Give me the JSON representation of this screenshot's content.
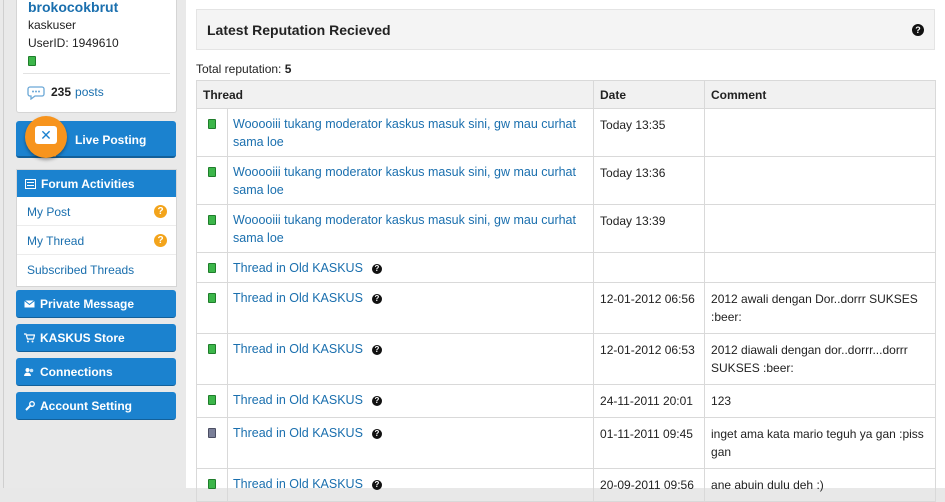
{
  "profile": {
    "username": "brokocokbrut",
    "user_title": "kaskuser",
    "user_id": "UserID: 1949610",
    "posts_count": "235",
    "posts_label": "posts"
  },
  "sidebar": {
    "live_posting": "Live Posting",
    "forum_activities": {
      "title": "Forum Activities",
      "items": [
        {
          "label": "My Post",
          "has_help": true
        },
        {
          "label": "My Thread",
          "has_help": true
        },
        {
          "label": "Subscribed Threads",
          "has_help": false
        }
      ]
    },
    "buttons": [
      {
        "label": "Private Message",
        "icon": "envelope-icon"
      },
      {
        "label": "KASKUS Store",
        "icon": "cart-icon"
      },
      {
        "label": "Connections",
        "icon": "people-icon"
      },
      {
        "label": "Account Setting",
        "icon": "wrench-icon"
      }
    ]
  },
  "main": {
    "title": "Latest Reputation Recieved",
    "total_label": "Total reputation:",
    "total_value": "5",
    "columns": [
      "Thread",
      "Date",
      "Comment"
    ],
    "rows": [
      {
        "status": "green",
        "thread": "Wooooiii tukang moderator kaskus masuk sini, gw mau curhat sama loe",
        "has_help": false,
        "date": "Today 13:35",
        "comment": ""
      },
      {
        "status": "green",
        "thread": "Wooooiii tukang moderator kaskus masuk sini, gw mau curhat sama loe",
        "has_help": false,
        "date": "Today 13:36",
        "comment": ""
      },
      {
        "status": "green",
        "thread": "Wooooiii tukang moderator kaskus masuk sini, gw mau curhat sama loe",
        "has_help": false,
        "date": "Today 13:39",
        "comment": ""
      },
      {
        "status": "green",
        "thread": "Thread in Old KASKUS",
        "has_help": true,
        "date": "",
        "comment": ""
      },
      {
        "status": "green",
        "thread": "Thread in Old KASKUS",
        "has_help": true,
        "date": "12-01-2012 06:56",
        "comment": "2012 awali dengan Dor..dorrr SUKSES :beer:"
      },
      {
        "status": "green",
        "thread": "Thread in Old KASKUS",
        "has_help": true,
        "date": "12-01-2012 06:53",
        "comment": "2012 diawali dengan dor..dorrr...dorrr SUKSES :beer:"
      },
      {
        "status": "green",
        "thread": "Thread in Old KASKUS",
        "has_help": true,
        "date": "24-11-2011 20:01",
        "comment": "123"
      },
      {
        "status": "gray",
        "thread": "Thread in Old KASKUS",
        "has_help": true,
        "date": "01-11-2011 09:45",
        "comment": "inget ama kata mario teguh ya gan :piss gan"
      },
      {
        "status": "green",
        "thread": "Thread in Old KASKUS",
        "has_help": true,
        "date": "20-09-2011 09:56",
        "comment": "ane abuin dulu deh :)"
      }
    ]
  },
  "colors": {
    "accent_blue": "#1b82cf",
    "link_blue": "#1a6fae",
    "live_orange": "#f7941d",
    "status_green": "#3cb64a",
    "status_gray": "#7a7f98"
  }
}
